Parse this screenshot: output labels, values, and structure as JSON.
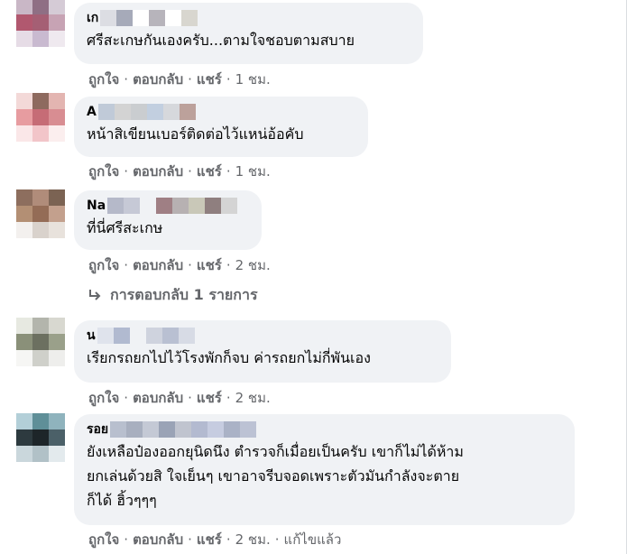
{
  "comments": [
    {
      "author": "เก",
      "text": "ศรีสะเกษกันเองครับ...ตามใจชอบตามสบาย",
      "like": "ถูกใจ",
      "reply": "ตอบกลับ",
      "share": "แชร์",
      "time": "1 ชม.",
      "edited": ""
    },
    {
      "author": "A",
      "text": "หน้าสิเขียนเบอร์ติดต่อไว้แหน่อ้อคับ",
      "like": "ถูกใจ",
      "reply": "ตอบกลับ",
      "share": "แชร์",
      "time": "1 ชม.",
      "edited": ""
    },
    {
      "author": "Na",
      "text": "ที่นี่ศรีสะเกษ",
      "like": "ถูกใจ",
      "reply": "ตอบกลับ",
      "share": "แชร์",
      "time": "2 ชม.",
      "edited": ""
    },
    {
      "author": "น",
      "text": "เรียกรถยกไปไว้โรงพักก็จบ ค่ารถยกไม่กี่พันเอง",
      "like": "ถูกใจ",
      "reply": "ตอบกลับ",
      "share": "แชร์",
      "time": "2 ชม.",
      "edited": ""
    },
    {
      "author": "รอย",
      "text": "ยังเหลือป๋องออกยุนิดนึง ตำรวจก็เมื่อยเป็นครับ เขาก็ไม่ได้ห้าม\nยกเล่นด้วยสิ ใจเย็นๆ เขาอาจรีบจอดเพราะตัวมันกำลังจะตาย\nก็ได้ ฮิ้วๆๆๆ",
      "like": "ถูกใจ",
      "reply": "ตอบกลับ",
      "share": "แชร์",
      "time": "2 ชม.",
      "edited": "แก้ไขแล้ว"
    }
  ],
  "replies_link": "การตอบกลับ 1 รายการ"
}
